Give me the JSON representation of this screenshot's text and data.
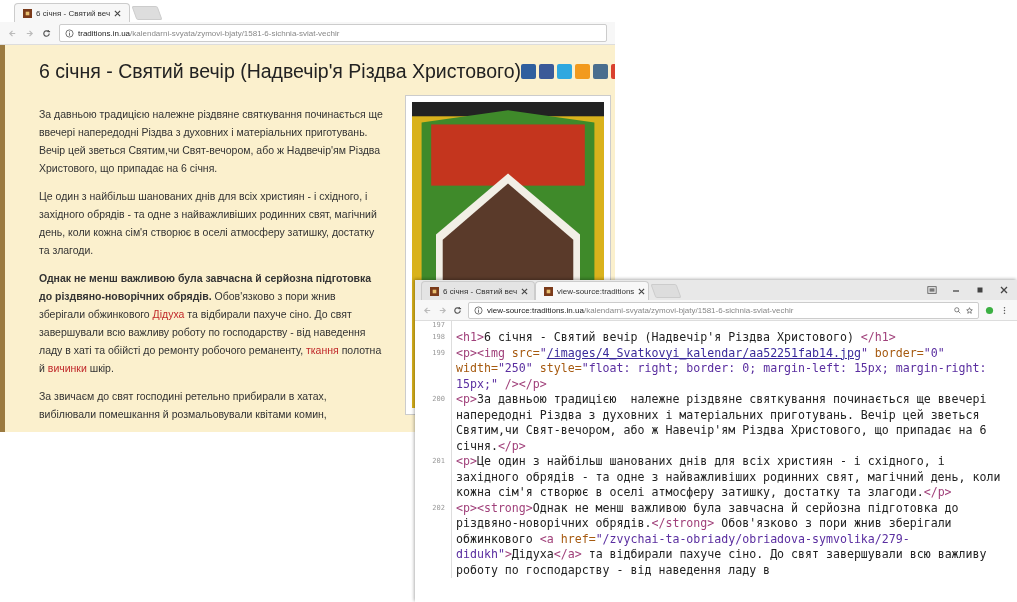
{
  "back_window": {
    "tabs": [
      {
        "title": "6 січня - Святий веч",
        "selected": true
      }
    ],
    "address": {
      "host": "traditions.in.ua",
      "path": "/kalendarni-svyata/zymovi-bjaty/1581-6-sichnia-sviat-vechir"
    },
    "heading": "6 січня - Святий вечір (Надвечір'я Різдва Христового)",
    "share_buttons": [
      {
        "color": "#2f5f9e"
      },
      {
        "color": "#3b5998"
      },
      {
        "color": "#2fa8e0"
      },
      {
        "color": "#f29a1d"
      },
      {
        "color": "#4a6e8e"
      },
      {
        "color": "#d9412e"
      }
    ],
    "paragraphs": [
      [
        {
          "kind": "plain",
          "text": "За давньою традицією  належне різдвяне святкування починається ще ввечері напередодні Різдва з духовних і матеріальних приготувань. Вечір цей зветься Святим,чи Свят-вечором, або ж Надвечір'ям Різдва Христового, що припадає на 6 січня."
        }
      ],
      [
        {
          "kind": "plain",
          "text": "Це один з найбільш шанованих днів для всіх християн - і східного, і західного обрядів - та одне з найважливіших родинних свят, магічний день, коли кожна сім'я створює в оселі атмосферу затишку, достатку та злагоди."
        }
      ],
      [
        {
          "kind": "bold",
          "text": "Однак не менш важливою була завчасна й серйозна підготовка до різдвяно-новорічних обрядів."
        },
        {
          "kind": "plain",
          "text": " Обов'язково з пори жнив зберігали обжинкового "
        },
        {
          "kind": "link",
          "text": "Дідуха"
        },
        {
          "kind": "plain",
          "text": " та відбирали пахуче сіно. До свят завершували всю важливу роботу по господарству - від наведення ладу в хаті та обійсті до ремонту робочого реманенту, "
        },
        {
          "kind": "link",
          "text": "ткання"
        },
        {
          "kind": "plain",
          "text": " полотна й "
        },
        {
          "kind": "link",
          "text": "вичинки"
        },
        {
          "kind": "plain",
          "text": " шкір."
        }
      ],
      [
        {
          "kind": "plain",
          "text": "За звичаєм до свят господині ретельно прибирали в хатах, вибілювали помешкання й розмальовували  квітами комин,"
        }
      ]
    ]
  },
  "front_window": {
    "tabs": [
      {
        "title": "6 січня - Святий веч",
        "selected": false
      },
      {
        "title": "view-source:traditions",
        "selected": true
      }
    ],
    "address": {
      "host": "view-source:traditions.in.ua",
      "path": "/kalendarni-svyata/zymovi-bjaty/1581-6-sichnia-sviat-vechir"
    },
    "code_lines": [
      {
        "number": "197"
      },
      {
        "number": "198",
        "segments": [
          {
            "kind": "tag",
            "text": "<h1>"
          },
          {
            "kind": "text",
            "text": "6 січня - Святий вечір (Надвечір'я Різдва Христового) "
          },
          {
            "kind": "tag",
            "text": "</h1>"
          }
        ]
      },
      {
        "number": "199",
        "segments": [
          {
            "kind": "tag",
            "text": "<p><img"
          },
          {
            "kind": "attr",
            "text": " src="
          },
          {
            "kind": "value",
            "text": "\""
          },
          {
            "kind": "link",
            "text": "/images/4_Svatkovyi_kalendar/aa52251fab14.jpg"
          },
          {
            "kind": "value",
            "text": "\""
          },
          {
            "kind": "attr",
            "text": " border="
          },
          {
            "kind": "value",
            "text": "\"0\""
          },
          {
            "kind": "attr",
            "text": " width="
          },
          {
            "kind": "value",
            "text": "\"250\""
          },
          {
            "kind": "attr",
            "text": " style="
          },
          {
            "kind": "value",
            "text": "\"float: right; border: 0; margin-left: 15px; margin-right: 15px;\""
          },
          {
            "kind": "tag",
            "text": " /></p>"
          }
        ]
      },
      {
        "number": "200",
        "segments": [
          {
            "kind": "tag",
            "text": "<p>"
          },
          {
            "kind": "text",
            "text": "За давньою традицією  належне різдвяне святкування починається ще ввечері напередодні Різдва з духовних і матеріальних приготувань. Вечір цей зветься Святим,чи Свят-вечором, або ж Навечір'ям Різдва Христового, що припадає на 6 січня."
          },
          {
            "kind": "tag",
            "text": "</p>"
          }
        ]
      },
      {
        "number": "201",
        "segments": [
          {
            "kind": "tag",
            "text": "<p>"
          },
          {
            "kind": "text",
            "text": "Це один з найбільш шанованих днів для всіх християн - і східного, і західного обрядів - та одне з найважливіших родинних свят, магічний день, коли кожна сім'я створює в оселі атмосферу затишку, достатку та злагоди."
          },
          {
            "kind": "tag",
            "text": "</p>"
          }
        ]
      },
      {
        "number": "202",
        "segments": [
          {
            "kind": "tag",
            "text": "<p><strong>"
          },
          {
            "kind": "text",
            "text": "Однак не менш важливою була завчасна й серйозна підготовка до різдвяно-новорічних обрядів."
          },
          {
            "kind": "tag",
            "text": "</strong>"
          },
          {
            "kind": "text",
            "text": " Обов'язково з пори жнив зберігали обжинкового "
          },
          {
            "kind": "tag",
            "text": "<a"
          },
          {
            "kind": "attr",
            "text": " href="
          },
          {
            "kind": "value",
            "text": "\"/zvychai-ta-obriady/obriadova-symvolika/279-didukh\""
          },
          {
            "kind": "tag",
            "text": ">"
          },
          {
            "kind": "text",
            "text": "Дідуха"
          },
          {
            "kind": "tag",
            "text": "</a>"
          },
          {
            "kind": "text",
            "text": " та відбирали пахуче сіно. До свят завершували всю важливу роботу по господарству - від наведення ладу в"
          }
        ]
      }
    ]
  }
}
